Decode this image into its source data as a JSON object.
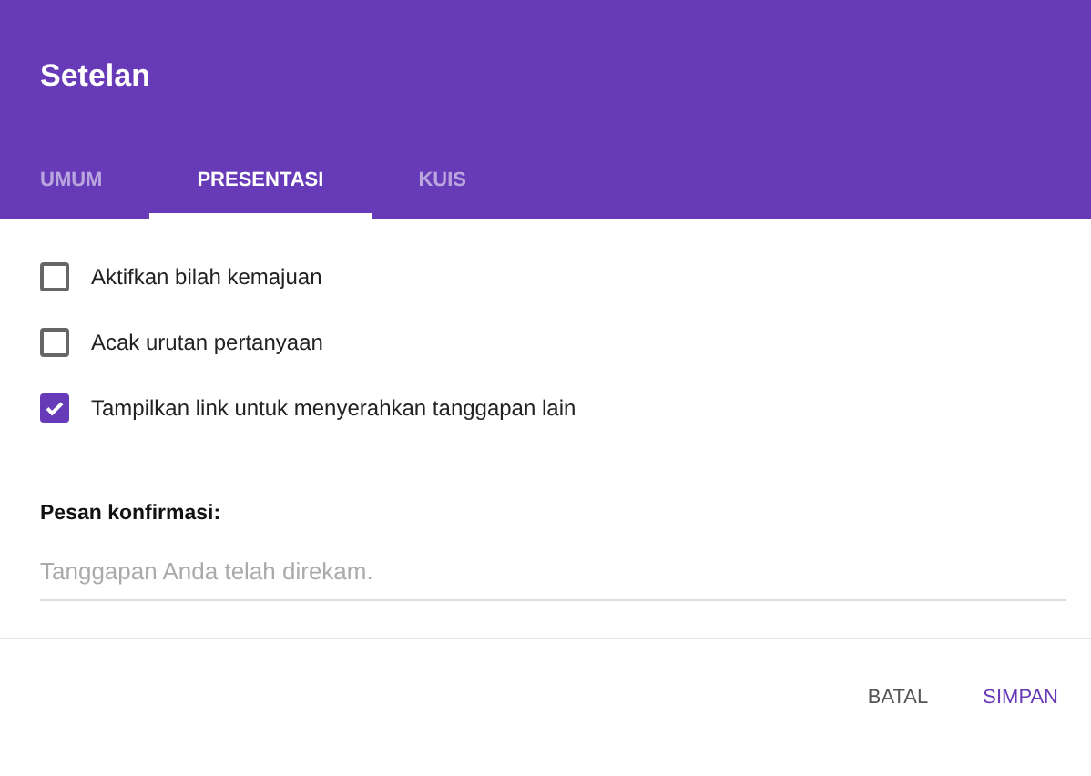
{
  "header": {
    "title": "Setelan"
  },
  "tabs": [
    {
      "label": "UMUM",
      "selected": false
    },
    {
      "label": "PRESENTASI",
      "selected": true
    },
    {
      "label": "KUIS",
      "selected": false
    }
  ],
  "options": [
    {
      "label": "Aktifkan bilah kemajuan",
      "checked": false
    },
    {
      "label": "Acak urutan pertanyaan",
      "checked": false
    },
    {
      "label": "Tampilkan link untuk menyerahkan tanggapan lain",
      "checked": true
    }
  ],
  "confirmation": {
    "label": "Pesan konfirmasi:",
    "placeholder": "Tanggapan Anda telah direkam."
  },
  "buttons": [
    {
      "label": "BATAL",
      "kind": "cancel"
    },
    {
      "label": "SIMPAN",
      "kind": "save"
    }
  ]
}
